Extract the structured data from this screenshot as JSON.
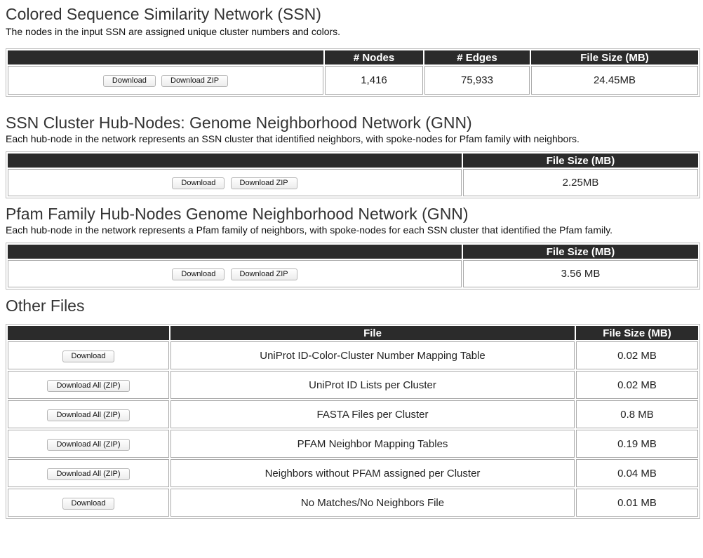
{
  "ssn": {
    "title": "Colored Sequence Similarity Network (SSN)",
    "description": "The nodes in the input SSN are assigned unique cluster numbers and colors.",
    "headers": {
      "blank": "",
      "nodes": "# Nodes",
      "edges": "# Edges",
      "size": "File Size (MB)"
    },
    "download_label": "Download",
    "download_zip_label": "Download ZIP",
    "nodes": "1,416",
    "edges": "75,933",
    "size": "24.45MB"
  },
  "gnn_cluster": {
    "title": "SSN Cluster Hub-Nodes: Genome Neighborhood Network (GNN)",
    "description": "Each hub-node in the network represents an SSN cluster that identified neighbors, with spoke-nodes for Pfam family with neighbors.",
    "headers": {
      "blank": "",
      "size": "File Size (MB)"
    },
    "download_label": "Download",
    "download_zip_label": "Download ZIP",
    "size": "2.25MB"
  },
  "gnn_pfam": {
    "title": "Pfam Family Hub-Nodes Genome Neighborhood Network (GNN)",
    "description": "Each hub-node in the network represents a Pfam family of neighbors, with spoke-nodes for each SSN cluster that identified the Pfam family.",
    "headers": {
      "blank": "",
      "size": "File Size (MB)"
    },
    "download_label": "Download",
    "download_zip_label": "Download ZIP",
    "size": "3.56 MB"
  },
  "other": {
    "title": "Other Files",
    "headers": {
      "blank": "",
      "file": "File",
      "size": "File Size (MB)"
    },
    "rows": [
      {
        "button": "Download",
        "file": "UniProt ID-Color-Cluster Number Mapping Table",
        "size": "0.02 MB"
      },
      {
        "button": "Download All (ZIP)",
        "file": "UniProt ID Lists per Cluster",
        "size": "0.02 MB"
      },
      {
        "button": "Download All (ZIP)",
        "file": "FASTA Files per Cluster",
        "size": "0.8 MB"
      },
      {
        "button": "Download All (ZIP)",
        "file": "PFAM Neighbor Mapping Tables",
        "size": "0.19 MB"
      },
      {
        "button": "Download All (ZIP)",
        "file": "Neighbors without PFAM assigned per Cluster",
        "size": "0.04 MB"
      },
      {
        "button": "Download",
        "file": "No Matches/No Neighbors File",
        "size": "0.01 MB"
      }
    ]
  }
}
